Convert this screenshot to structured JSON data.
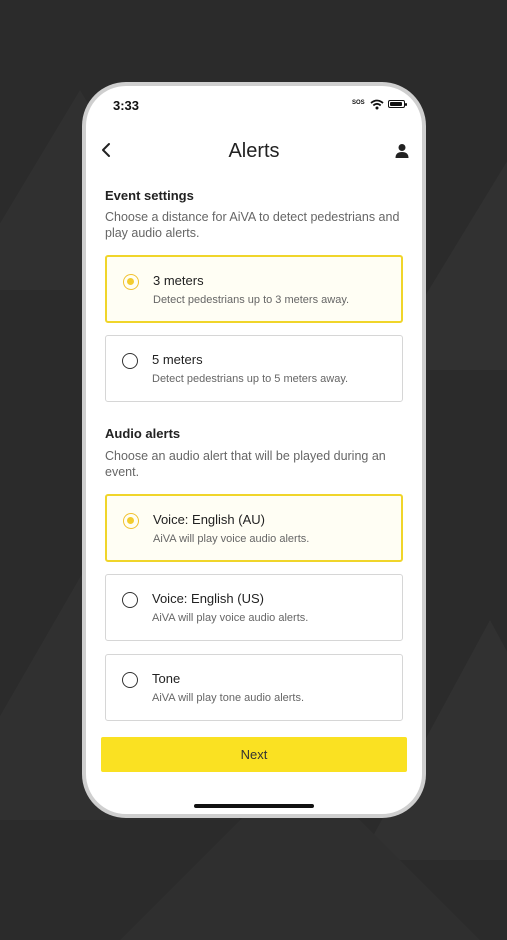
{
  "status_bar": {
    "time": "3:33",
    "sos": "SOS"
  },
  "header": {
    "title": "Alerts"
  },
  "event_settings": {
    "title": "Event settings",
    "description": "Choose a distance for AiVA to detect pedestrians and play audio alerts.",
    "options": [
      {
        "label": "3 meters",
        "sublabel": "Detect pedestrians up to 3 meters away.",
        "selected": true
      },
      {
        "label": "5 meters",
        "sublabel": "Detect pedestrians up to 5 meters away.",
        "selected": false
      }
    ]
  },
  "audio_alerts": {
    "title": "Audio alerts",
    "description": "Choose an audio alert that will be played during an event.",
    "options": [
      {
        "label": "Voice: English (AU)",
        "sublabel": "AiVA will play voice audio alerts.",
        "selected": true
      },
      {
        "label": "Voice: English (US)",
        "sublabel": "AiVA will play voice audio alerts.",
        "selected": false
      },
      {
        "label": "Tone",
        "sublabel": "AiVA will play tone audio alerts.",
        "selected": false
      }
    ]
  },
  "footer": {
    "next_label": "Next"
  },
  "colors": {
    "accent": "#fae122",
    "selected_border": "#f0d52a",
    "background": "#2b2b2b"
  },
  "icons": [
    "back-chevron-icon",
    "user-icon",
    "wifi-icon",
    "battery-icon"
  ]
}
